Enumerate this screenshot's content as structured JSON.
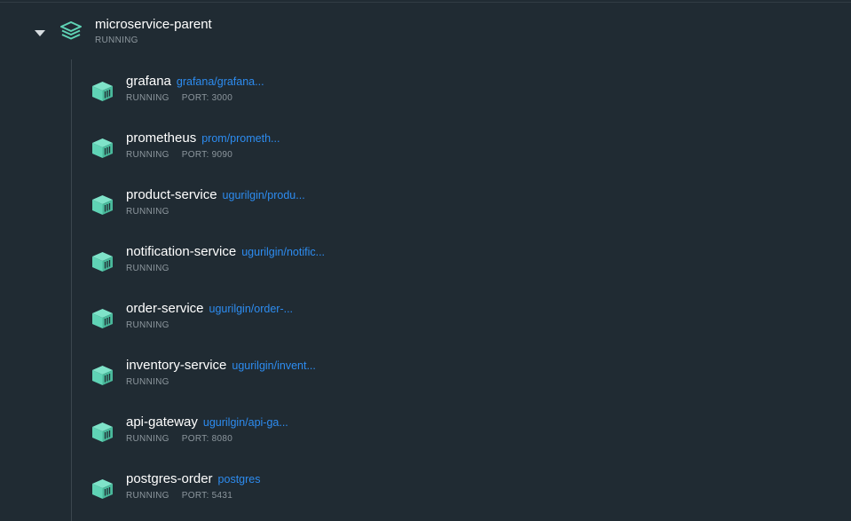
{
  "group": {
    "name": "microservice-parent",
    "status": "RUNNING",
    "icon": "stack-icon",
    "accent_color": "#5fd3b5"
  },
  "containers": [
    {
      "name": "grafana",
      "image": "grafana/grafana...",
      "status": "RUNNING",
      "port": "PORT: 3000"
    },
    {
      "name": "prometheus",
      "image": "prom/prometh...",
      "status": "RUNNING",
      "port": "PORT: 9090"
    },
    {
      "name": "product-service",
      "image": "ugurilgin/produ...",
      "status": "RUNNING",
      "port": ""
    },
    {
      "name": "notification-service",
      "image": "ugurilgin/notific...",
      "status": "RUNNING",
      "port": ""
    },
    {
      "name": "order-service",
      "image": "ugurilgin/order-...",
      "status": "RUNNING",
      "port": ""
    },
    {
      "name": "inventory-service",
      "image": "ugurilgin/invent...",
      "status": "RUNNING",
      "port": ""
    },
    {
      "name": "api-gateway",
      "image": "ugurilgin/api-ga...",
      "status": "RUNNING",
      "port": "PORT: 8080"
    },
    {
      "name": "postgres-order",
      "image": "postgres",
      "status": "RUNNING",
      "port": "PORT: 5431"
    }
  ],
  "colors": {
    "background": "#202b33",
    "name_text": "#ffffff",
    "status_text": "#8d979e",
    "image_link": "#2d8cf0",
    "container_icon": "#5fd3b5"
  }
}
